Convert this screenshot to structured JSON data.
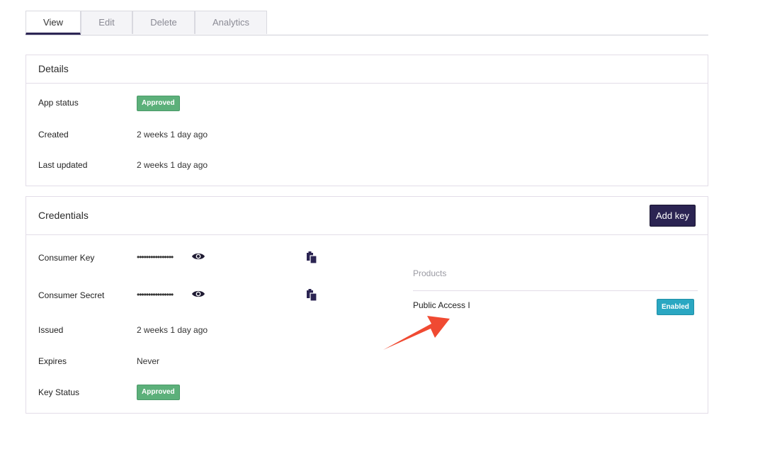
{
  "tabs": [
    {
      "label": "View",
      "active": true
    },
    {
      "label": "Edit",
      "active": false
    },
    {
      "label": "Delete",
      "active": false
    },
    {
      "label": "Analytics",
      "active": false
    }
  ],
  "details": {
    "title": "Details",
    "app_status_label": "App status",
    "app_status_value": "Approved",
    "created_label": "Created",
    "created_value": "2 weeks 1 day ago",
    "updated_label": "Last updated",
    "updated_value": "2 weeks 1 day ago"
  },
  "credentials": {
    "title": "Credentials",
    "add_key_label": "Add key",
    "consumer_key_label": "Consumer Key",
    "consumer_key_masked": "••••••••••••••••",
    "consumer_secret_label": "Consumer Secret",
    "consumer_secret_masked": "••••••••••••••••",
    "issued_label": "Issued",
    "issued_value": "2 weeks 1 day ago",
    "expires_label": "Expires",
    "expires_value": "Never",
    "key_status_label": "Key Status",
    "key_status_value": "Approved",
    "products_title": "Products",
    "products": [
      {
        "name": "Public Access I",
        "status": "Enabled"
      }
    ]
  },
  "icons": {
    "reveal": "eye-icon",
    "copy": "clipboard-icon",
    "annotation": "red-arrow"
  },
  "colors": {
    "approved": "#5cb07a",
    "enabled": "#2aa7c2",
    "primary_button": "#2b2452",
    "annotation_arrow": "#f04a32"
  }
}
